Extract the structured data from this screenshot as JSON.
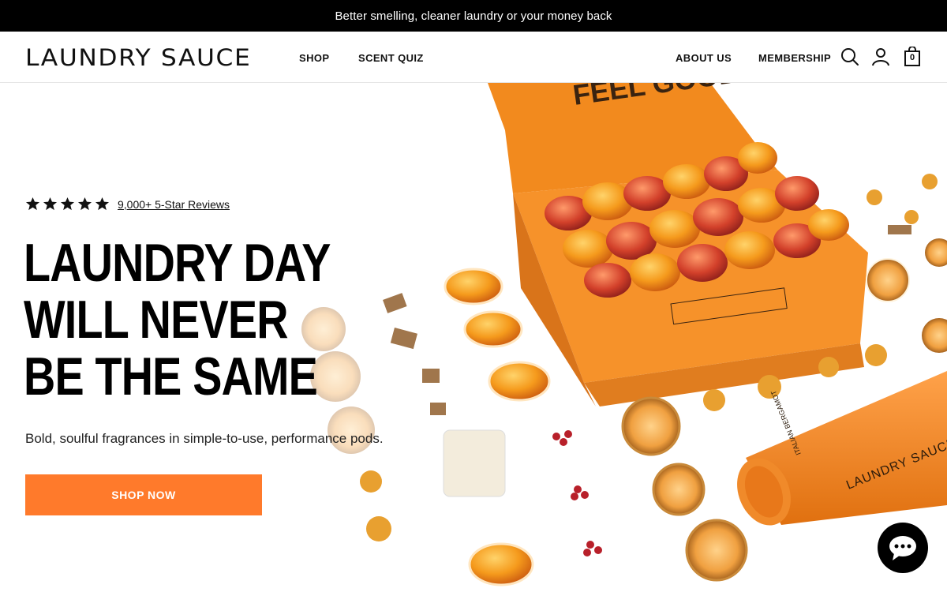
{
  "announcement": "Better smelling, cleaner laundry or your money back",
  "header": {
    "logo": "LAUNDRY SAUCE",
    "nav": {
      "shop": "SHOP",
      "scent_quiz": "SCENT QUIZ",
      "about_us": "ABOUT US",
      "membership": "MEMBERSHIP"
    },
    "icons": [
      "search-icon",
      "account-icon",
      "cart-icon"
    ],
    "cart_count": "0"
  },
  "hero": {
    "rating_stars": 5,
    "reviews_link": "9,000+ 5-Star Reviews",
    "headline": [
      "LAUNDRY DAY",
      "WILL NEVER",
      "BE THE SAME"
    ],
    "subtext": "Bold, soulful fragrances in simple-to-use, performance pods.",
    "cta": "SHOP NOW",
    "product_box_text": "FEEL GOOD",
    "tube_text": "LAUNDRY SAUCE",
    "tube_scent": "ITALIAN BERGAMOT"
  },
  "colors": {
    "accent": "#ff7a2b",
    "box_orange": "#f28a1e",
    "announcement_bg": "#000000"
  },
  "chat": {
    "icon": "chat-icon"
  }
}
